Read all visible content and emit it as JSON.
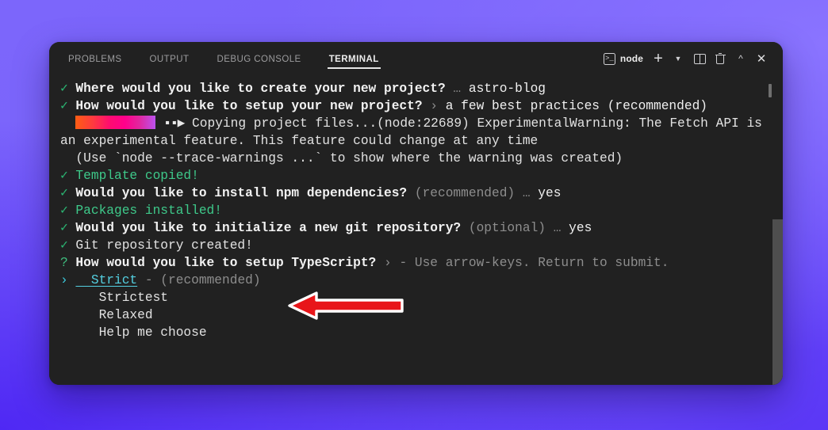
{
  "window": {
    "title": "Terminal",
    "tabs": [
      {
        "label": "PROBLEMS",
        "active": false
      },
      {
        "label": "OUTPUT",
        "active": false
      },
      {
        "label": "DEBUG CONSOLE",
        "active": false
      },
      {
        "label": "TERMINAL",
        "active": true
      }
    ],
    "actions": {
      "shell_chip_label": "node",
      "shell_chip_icon": "terminal-prompt-icon",
      "new_terminal_icon": "plus-icon",
      "new_terminal_dropdown_icon": "chevron-down-icon",
      "split_terminal_icon": "split-panel-icon",
      "kill_terminal_icon": "trash-icon",
      "maximize_panel_icon": "chevron-up-icon",
      "close_panel_icon": "close-x-icon"
    }
  },
  "terminal": {
    "lines": [
      {
        "id": "line-create-project",
        "mark": "✓",
        "mark_type": "ok",
        "segments": [
          {
            "text": "Where would you like to create your new project?",
            "style": "bold"
          },
          {
            "text": " … ",
            "style": "dim"
          },
          {
            "text": "astro-blog",
            "style": "answer"
          }
        ]
      },
      {
        "id": "line-setup-project",
        "mark": "✓",
        "mark_type": "ok",
        "segments": [
          {
            "text": "How would you like to setup your new project?",
            "style": "bold"
          },
          {
            "text": " › ",
            "style": "dim"
          },
          {
            "text": "a few best practices (recommended)",
            "style": "answer"
          }
        ]
      },
      {
        "id": "line-copying-files",
        "mark": "",
        "mark_type": "none",
        "gradient_bar": true,
        "spinner": "▪▪▶",
        "segments": [
          {
            "text": "Copying project files...(node:22689) ExperimentalWarning: The Fetch API is an experimental feature. This feature could change at any time",
            "style": "plain"
          }
        ]
      },
      {
        "id": "line-trace-warnings",
        "mark": "",
        "mark_type": "none",
        "segments": [
          {
            "text": "(Use `node --trace-warnings ...` to show where the warning was created)",
            "style": "plain"
          }
        ]
      },
      {
        "id": "line-template-copied",
        "mark": "✓",
        "mark_type": "ok",
        "segments": [
          {
            "text": "Template copied!",
            "style": "green"
          }
        ]
      },
      {
        "id": "line-install-npm",
        "mark": "✓",
        "mark_type": "ok",
        "segments": [
          {
            "text": "Would you like to install npm dependencies?",
            "style": "bold"
          },
          {
            "text": " (recommended) … ",
            "style": "dim"
          },
          {
            "text": "yes",
            "style": "answer"
          }
        ]
      },
      {
        "id": "line-packages-installed",
        "mark": "✓",
        "mark_type": "ok",
        "segments": [
          {
            "text": "Packages installed!",
            "style": "green"
          }
        ]
      },
      {
        "id": "line-init-git",
        "mark": "✓",
        "mark_type": "ok",
        "segments": [
          {
            "text": "Would you like to initialize a new git repository?",
            "style": "bold"
          },
          {
            "text": " (optional) … ",
            "style": "dim"
          },
          {
            "text": "yes",
            "style": "answer"
          }
        ]
      },
      {
        "id": "line-git-created",
        "mark": "✓",
        "mark_type": "ok",
        "segments": [
          {
            "text": "Git repository created!",
            "style": "plain"
          }
        ]
      },
      {
        "id": "line-setup-typescript",
        "mark": "?",
        "mark_type": "q",
        "segments": [
          {
            "text": "How would you like to setup TypeScript?",
            "style": "bold"
          },
          {
            "text": " › ",
            "style": "dim"
          },
          {
            "text": "- Use arrow-keys. Return to submit.",
            "style": "dim"
          }
        ]
      },
      {
        "id": "line-option-strict",
        "mark": "›",
        "mark_type": "ptr",
        "segments": [
          {
            "text": "  Strict",
            "style": "cyan-underline"
          },
          {
            "text": " - ",
            "style": "dim"
          },
          {
            "text": "(recommended)",
            "style": "dim"
          }
        ]
      },
      {
        "id": "line-option-strictest",
        "mark": "",
        "mark_type": "none",
        "segments": [
          {
            "text": "   Strictest",
            "style": "plain"
          }
        ]
      },
      {
        "id": "line-option-relaxed",
        "mark": "",
        "mark_type": "none",
        "segments": [
          {
            "text": "   Relaxed",
            "style": "plain"
          }
        ]
      },
      {
        "id": "line-option-help",
        "mark": "",
        "mark_type": "none",
        "segments": [
          {
            "text": "   Help me choose",
            "style": "plain"
          }
        ]
      }
    ],
    "menu_options": [
      "Strict",
      "Strictest",
      "Relaxed",
      "Help me choose"
    ],
    "selected_option": "Strict"
  },
  "annotation": {
    "arrow_direction": "left",
    "arrow_color": "#e8161a",
    "arrow_outline_color": "#ffffff"
  },
  "colors": {
    "desktop_gradient_from": "#7c66fb",
    "desktop_gradient_to": "#5430f5",
    "terminal_background": "#212121",
    "success_green": "#3ec98a",
    "selected_cyan": "#54cfe0",
    "progress_gradient_start": "#ff5d13",
    "progress_gradient_mid": "#ff008b",
    "progress_gradient_end": "#bc52ee"
  }
}
